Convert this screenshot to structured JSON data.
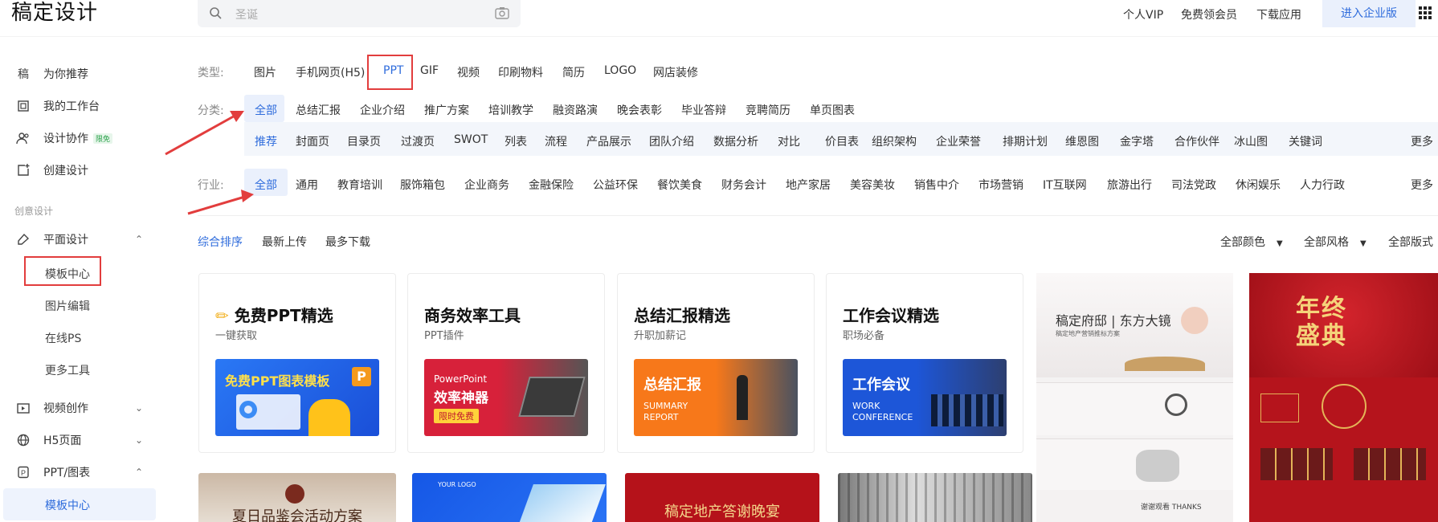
{
  "header": {
    "logo": "稿定设计",
    "search_placeholder": "圣诞",
    "nav": [
      "个人VIP",
      "免费领会员",
      "下载应用"
    ],
    "enterprise": "进入企业版"
  },
  "sidebar": {
    "top_items": [
      "为你推荐",
      "我的工作台",
      "设计协作",
      "创建设计"
    ],
    "collab_badge": "限免",
    "group_label": "创意设计",
    "flat_design": "平面设计",
    "flat_subs": [
      "模板中心",
      "图片编辑",
      "在线PS",
      "更多工具"
    ],
    "video": "视频创作",
    "h5": "H5页面",
    "ppt": "PPT/图表",
    "ppt_sub": "模板中心"
  },
  "filters": {
    "type_label": "类型:",
    "types": [
      "图片",
      "手机网页(H5)",
      "PPT",
      "GIF",
      "视频",
      "印刷物料",
      "简历",
      "LOGO",
      "网店装修"
    ],
    "category_label": "分类:",
    "categories": [
      "全部",
      "总结汇报",
      "企业介绍",
      "推广方案",
      "培训教学",
      "融资路演",
      "晚会表彰",
      "毕业答辩",
      "竞聘简历",
      "单页图表"
    ],
    "subcategories": [
      "推荐",
      "封面页",
      "目录页",
      "过渡页",
      "SWOT",
      "列表",
      "流程",
      "产品展示",
      "团队介绍",
      "数据分析",
      "对比",
      "价目表",
      "组织架构",
      "企业荣誉",
      "排期计划",
      "维恩图",
      "金字塔",
      "合作伙伴",
      "冰山图",
      "关键词"
    ],
    "more": "更多",
    "industry_label": "行业:",
    "industries": [
      "全部",
      "通用",
      "教育培训",
      "服饰箱包",
      "企业商务",
      "金融保险",
      "公益环保",
      "餐饮美食",
      "财务会计",
      "地产家居",
      "美容美妆",
      "销售中介",
      "市场营销",
      "IT互联网",
      "旅游出行",
      "司法党政",
      "休闲娱乐",
      "人力行政"
    ]
  },
  "sort": {
    "options": [
      "综合排序",
      "最新上传",
      "最多下载"
    ],
    "dropdowns": [
      "全部颜色",
      "全部风格",
      "全部版式"
    ]
  },
  "cards": [
    {
      "title": "免费PPT精选",
      "subtitle": "一键获取",
      "banner": "免费PPT图表模板",
      "color": "#1f5fe0"
    },
    {
      "title": "商务效率工具",
      "subtitle": "PPT插件",
      "banner_line1": "PowerPoint",
      "banner_line2": "效率神器",
      "banner_tag": "限时免费",
      "color": "#d9233a"
    },
    {
      "title": "总结汇报精选",
      "subtitle": "升职加薪记",
      "banner": "总结汇报",
      "banner_en1": "SUMMARY",
      "banner_en2": "REPORT",
      "color": "#f06a12"
    },
    {
      "title": "工作会议精选",
      "subtitle": "职场必备",
      "banner": "工作会议",
      "banner_en1": "WORK",
      "banner_en2": "CONFERENCE",
      "color": "#1d56d8"
    }
  ],
  "thumbs": {
    "estate_title": "稿定府邸 | 东方大镜",
    "estate_sub": "稿定地产营销推标方案",
    "estate_thanks": "谢谢观看 THANKS",
    "newyear": "年终盛典",
    "row2": [
      "夏日品鉴会活动方案",
      "YOUR LOGO",
      "稿定地产答谢晚宴",
      ""
    ]
  }
}
